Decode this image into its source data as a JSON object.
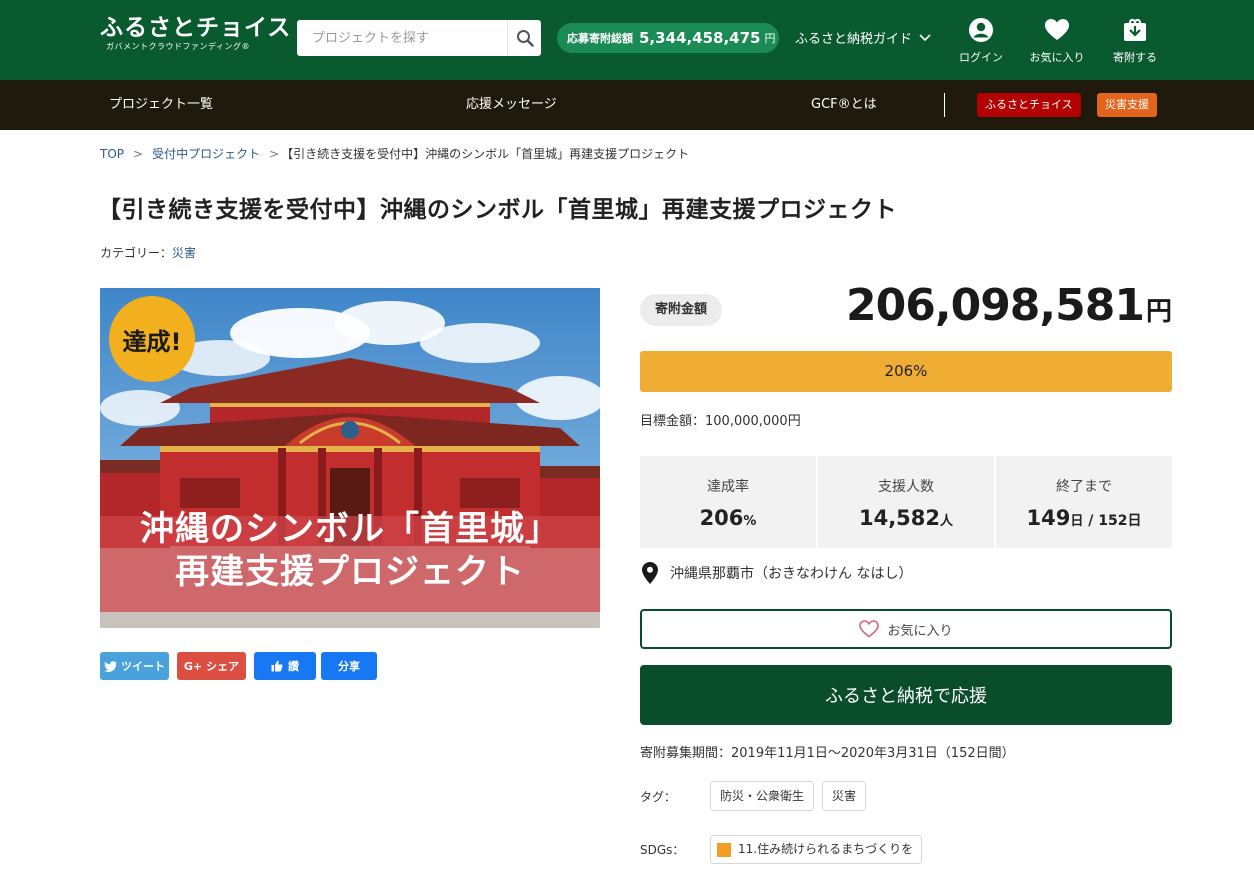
{
  "header": {
    "logo_main": "ふるさとチョイス",
    "logo_sub": "ガバメントクラウドファンディング®",
    "search_placeholder": "プロジェクトを探す",
    "total_label": "応募寄附総額",
    "total_value": "5,344,458,475",
    "total_unit": "円",
    "guide_label": "ふるさと納税ガイド",
    "login_label": "ログイン",
    "favorites_label": "お気に入り",
    "donate_label": "寄附する"
  },
  "nav": {
    "projects": "プロジェクト一覧",
    "messages": "応援メッセージ",
    "gcf": "GCF®とは",
    "badge_choice": "ふるさとチョイス",
    "badge_disaster": "災害支援",
    "badge_choice_color": "#b30000",
    "badge_disaster_color": "#e2651b"
  },
  "breadcrumb": {
    "top": "TOP",
    "projects": "受付中プロジェクト",
    "current": "【引き続き支援を受付中】沖縄のシンボル「首里城」再建支援プロジェクト"
  },
  "page": {
    "title": "【引き続き支援を受付中】沖縄のシンボル「首里城」再建支援プロジェクト",
    "category_label": "カテゴリー：",
    "category_value": "災害"
  },
  "hero": {
    "badge": "達成!",
    "caption_line1": "沖縄のシンボル「首里城」",
    "caption_line2": "再建支援プロジェクト"
  },
  "share": {
    "tweet": "ツイート",
    "gplus": "シェア",
    "like": "讚",
    "share": "分享"
  },
  "funding": {
    "label": "寄附金額",
    "amount": "206,098,581",
    "unit": "円",
    "progress_percent": 206,
    "progress_text": "206%",
    "target": "目標金額：100,000,000円"
  },
  "stats": {
    "rate_label": "達成率",
    "rate_value": "206",
    "rate_unit": "%",
    "supporters_label": "支援人数",
    "supporters_value": "14,582",
    "supporters_unit": "人",
    "remaining_label": "終了まで",
    "remaining_value": "149",
    "remaining_unit": "日",
    "remaining_total": " / 152日"
  },
  "location": "沖縄県那覇市（おきなわけん なはし）",
  "actions": {
    "favorite": "お気に入り",
    "support": "ふるさと納税で応援"
  },
  "details": {
    "period": "寄附募集期間：2019年11月1日～2020年3月31日（152日間）",
    "tags_label": "タグ：",
    "tags": [
      "防災・公衆衛生",
      "災害"
    ],
    "sdgs_label": "SDGs：",
    "sdg": "11.住み続けられるまちづくりを"
  }
}
